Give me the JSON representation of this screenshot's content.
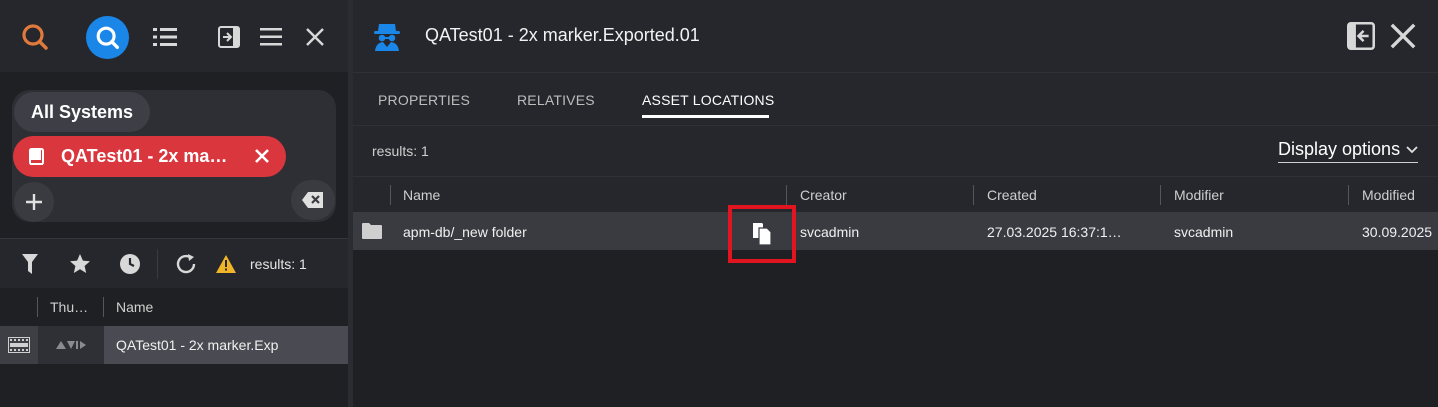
{
  "left_panel": {
    "toolbar_icons": [
      "search-icon",
      "search-active-icon",
      "list-icon",
      "panel-collapse-icon",
      "menu-icon",
      "close-icon"
    ],
    "chips": {
      "all_systems": "All Systems",
      "active_chip": "QATest01 - 2x ma…"
    },
    "results": "results: 1",
    "columns": {
      "thumbnail": "Thu…",
      "name": "Name"
    },
    "rows": [
      {
        "name": "QATest01 - 2x marker.Exp"
      }
    ]
  },
  "right_panel": {
    "title": "QATest01 - 2x marker.Exported.01",
    "tabs": [
      {
        "label": "PROPERTIES",
        "active": false
      },
      {
        "label": "RELATIVES",
        "active": false
      },
      {
        "label": "ASSET LOCATIONS",
        "active": true
      }
    ],
    "results": "results: 1",
    "display_options": "Display options",
    "columns": {
      "name": "Name",
      "creator": "Creator",
      "created": "Created",
      "modifier": "Modifier",
      "modified": "Modified"
    },
    "rows": [
      {
        "name": "apm-db/_new folder",
        "creator": "svcadmin",
        "created": "27.03.2025 16:37:1…",
        "modifier": "svcadmin",
        "modified": "30.09.2025"
      }
    ]
  },
  "colors": {
    "accent_blue": "#1a86e8",
    "chip_red": "#d9363e",
    "highlight_red": "#e0151f",
    "search_orange": "#e07a3c"
  }
}
